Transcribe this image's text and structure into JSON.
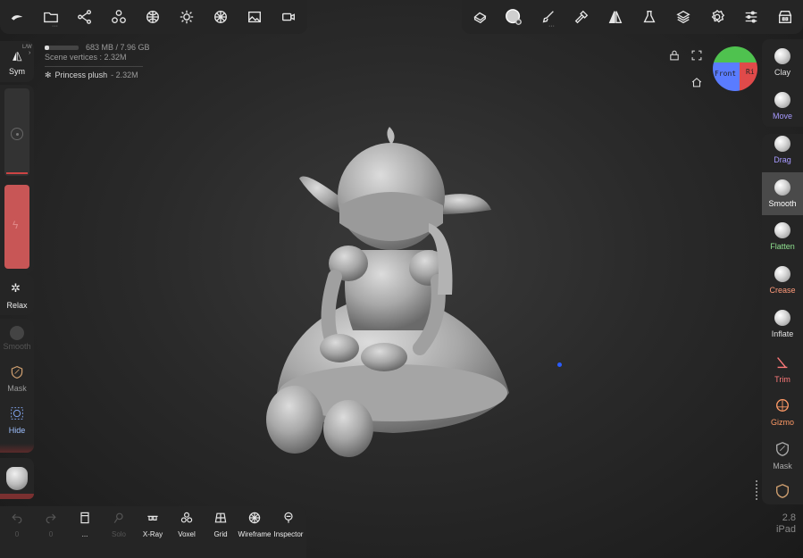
{
  "top_toolbar_left": {
    "icons": [
      "logo-icon",
      "folder-icon",
      "scene-graph-icon",
      "multi-object-icon",
      "sphere-grid-icon",
      "light-icon",
      "material-ball-icon",
      "image-icon",
      "camera-icon"
    ]
  },
  "top_toolbar_right": {
    "icons": [
      "stamp-icon",
      "brush-sphere-icon",
      "paint-brush-icon",
      "hammer-icon",
      "symmetry-icon",
      "flask-icon",
      "layers-icon",
      "settings-icon",
      "sliders-icon",
      "store-icon"
    ]
  },
  "stats": {
    "memory": "683 MB / 7.96 GB",
    "vertices": "Scene vertices : 2.32M",
    "object_name": "Princess plush",
    "object_vertices": "- 2.32M"
  },
  "left": {
    "sym": "Sym",
    "lw": "L/W",
    "relax": "Relax",
    "smooth": "Smooth",
    "mask": "Mask",
    "hide": "Hide"
  },
  "right_tools": [
    {
      "label": "Clay",
      "color": "#e0e0e0"
    },
    {
      "label": "Move",
      "color": "#a79aff"
    },
    {
      "label": "Drag",
      "color": "#a79aff"
    },
    {
      "label": "Smooth",
      "color": "#ffffff"
    },
    {
      "label": "Flatten",
      "color": "#8fe08f"
    },
    {
      "label": "Crease",
      "color": "#ff9a7a"
    },
    {
      "label": "Inflate",
      "color": "#e0e0e0"
    },
    {
      "label": "Trim",
      "color": "#ff7a7a"
    },
    {
      "label": "Gizmo",
      "color": "#ff9a66"
    },
    {
      "label": "Mask",
      "color": "#aaaaaa"
    }
  ],
  "gizmo": {
    "front": "Front",
    "right": "Ri"
  },
  "bottom": {
    "undo_count": "0",
    "redo_count": "0",
    "more": "...",
    "solo": "Solo",
    "xray": "X-Ray",
    "voxel": "Voxel",
    "grid": "Grid",
    "wireframe": "Wireframe",
    "inspector": "Inspector"
  },
  "version": {
    "number": "2.8",
    "device": "iPad"
  }
}
